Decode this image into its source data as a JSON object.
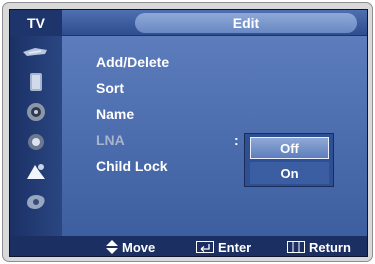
{
  "header": {
    "tv_label": "TV",
    "title": "Edit"
  },
  "sidebar": {
    "icons": [
      "picture-icon",
      "sound-icon",
      "channel-icon",
      "setup-icon",
      "input-icon",
      "application-icon"
    ]
  },
  "menu": {
    "items": [
      {
        "label": "Add/Delete",
        "enabled": true
      },
      {
        "label": "Sort",
        "enabled": true
      },
      {
        "label": "Name",
        "enabled": true
      },
      {
        "label": "LNA",
        "enabled": false
      },
      {
        "label": "Child Lock",
        "enabled": true
      }
    ],
    "separator": ":",
    "dropdown": {
      "options": [
        "Off",
        "On"
      ],
      "selected": "Off"
    }
  },
  "footer": {
    "move": "Move",
    "enter": "Enter",
    "return": "Return"
  },
  "colors": {
    "background": "#3a5a9a",
    "header": "#2e4d8e",
    "footer": "#1b2f63",
    "frame": "#d9d9d9"
  }
}
